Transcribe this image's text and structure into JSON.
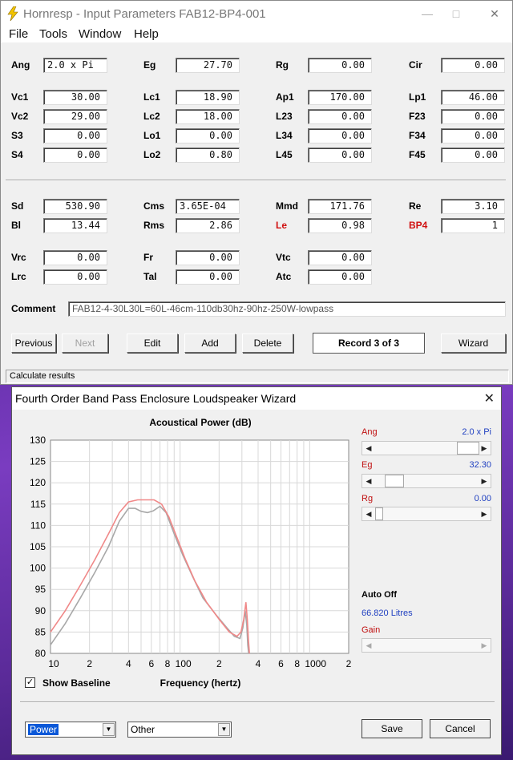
{
  "main_window": {
    "title": "Hornresp - Input Parameters   FAB12-BP4-001",
    "menu": [
      "File",
      "Tools",
      "Window",
      "Help"
    ],
    "params": {
      "ang": {
        "label": "Ang",
        "value": "2.0 x Pi"
      },
      "eg": {
        "label": "Eg",
        "value": "27.70"
      },
      "rg": {
        "label": "Rg",
        "value": "0.00"
      },
      "cir": {
        "label": "Cir",
        "value": "0.00"
      },
      "vc1": {
        "label": "Vc1",
        "value": "30.00"
      },
      "lc1": {
        "label": "Lc1",
        "value": "18.90"
      },
      "ap1": {
        "label": "Ap1",
        "value": "170.00"
      },
      "lp1": {
        "label": "Lp1",
        "value": "46.00"
      },
      "vc2": {
        "label": "Vc2",
        "value": "29.00"
      },
      "lc2": {
        "label": "Lc2",
        "value": "18.00"
      },
      "l23": {
        "label": "L23",
        "value": "0.00"
      },
      "f23": {
        "label": "F23",
        "value": "0.00"
      },
      "s3": {
        "label": "S3",
        "value": "0.00"
      },
      "lo1": {
        "label": "Lo1",
        "value": "0.00"
      },
      "l34": {
        "label": "L34",
        "value": "0.00"
      },
      "f34": {
        "label": "F34",
        "value": "0.00"
      },
      "s4": {
        "label": "S4",
        "value": "0.00"
      },
      "lo2": {
        "label": "Lo2",
        "value": "0.80"
      },
      "l45": {
        "label": "L45",
        "value": "0.00"
      },
      "f45": {
        "label": "F45",
        "value": "0.00"
      },
      "sd": {
        "label": "Sd",
        "value": "530.90"
      },
      "cms": {
        "label": "Cms",
        "value": "3.65E-04"
      },
      "mmd": {
        "label": "Mmd",
        "value": "171.76"
      },
      "re": {
        "label": "Re",
        "value": "3.10"
      },
      "bl": {
        "label": "Bl",
        "value": "13.44"
      },
      "rms": {
        "label": "Rms",
        "value": "2.86"
      },
      "le": {
        "label": "Le",
        "value": "0.98"
      },
      "bp4": {
        "label": "BP4",
        "value": "1"
      },
      "vrc": {
        "label": "Vrc",
        "value": "0.00"
      },
      "fr": {
        "label": "Fr",
        "value": "0.00"
      },
      "vtc": {
        "label": "Vtc",
        "value": "0.00"
      },
      "lrc": {
        "label": "Lrc",
        "value": "0.00"
      },
      "tal": {
        "label": "Tal",
        "value": "0.00"
      },
      "atc": {
        "label": "Atc",
        "value": "0.00"
      }
    },
    "comment_label": "Comment",
    "comment": "FAB12-4-30L30L=60L-46cm-110db30hz-90hz-250W-lowpass",
    "buttons": {
      "previous": "Previous",
      "next": "Next",
      "edit": "Edit",
      "add": "Add",
      "delete": "Delete",
      "record": "Record 3 of 3",
      "wizard": "Wizard"
    },
    "status": "Calculate results",
    "colors": {
      "red_label": "#d01010"
    }
  },
  "wizard": {
    "title": "Fourth Order Band Pass Enclosure Loudspeaker Wizard",
    "controls": {
      "ang": {
        "label": "Ang",
        "value": "2.0 x Pi"
      },
      "eg": {
        "label": "Eg",
        "value": "32.30"
      },
      "rg": {
        "label": "Rg",
        "value": "0.00"
      },
      "auto_off": "Auto Off",
      "litres": "66.820 Litres",
      "gain": {
        "label": "Gain"
      }
    },
    "show_baseline": "Show Baseline",
    "dropdown1": "Power",
    "dropdown2": "Other",
    "save": "Save",
    "cancel": "Cancel",
    "colors": {
      "value_blue": "#1f3fc0",
      "current_curve": "#f08888",
      "baseline_curve": "#a8a8a8"
    }
  },
  "chart_data": {
    "type": "line",
    "title": "Acoustical Power (dB)",
    "xlabel": "Frequency (hertz)",
    "ylabel": "",
    "x_scale": "log",
    "xlim": [
      10,
      2000
    ],
    "ylim": [
      80,
      130
    ],
    "y_ticks": [
      130,
      125,
      120,
      115,
      110,
      105,
      100,
      95,
      90,
      85,
      80
    ],
    "x_tick_labels": [
      {
        "x": 10,
        "label": "10"
      },
      {
        "x": 20,
        "label": "2"
      },
      {
        "x": 40,
        "label": "4"
      },
      {
        "x": 60,
        "label": "6"
      },
      {
        "x": 80,
        "label": "8"
      },
      {
        "x": 100,
        "label": "100"
      },
      {
        "x": 200,
        "label": "2"
      },
      {
        "x": 400,
        "label": "4"
      },
      {
        "x": 600,
        "label": "6"
      },
      {
        "x": 800,
        "label": "8"
      },
      {
        "x": 1000,
        "label": "1000"
      },
      {
        "x": 2000,
        "label": "2"
      }
    ],
    "grid": true,
    "series": [
      {
        "color": "#f08888",
        "points": [
          [
            10,
            85
          ],
          [
            13,
            90
          ],
          [
            17,
            96
          ],
          [
            22,
            102
          ],
          [
            28,
            108
          ],
          [
            34,
            113
          ],
          [
            40,
            115.5
          ],
          [
            47,
            116
          ],
          [
            55,
            116
          ],
          [
            63,
            116
          ],
          [
            72,
            115
          ],
          [
            82,
            112
          ],
          [
            95,
            107
          ],
          [
            110,
            102
          ],
          [
            130,
            97
          ],
          [
            160,
            92
          ],
          [
            200,
            88
          ],
          [
            240,
            85
          ],
          [
            275,
            84
          ],
          [
            295,
            85
          ],
          [
            310,
            88
          ],
          [
            322,
            92
          ],
          [
            330,
            88
          ],
          [
            337,
            83
          ],
          [
            343,
            80
          ]
        ]
      },
      {
        "color": "#a8a8a8",
        "points": [
          [
            10,
            82
          ],
          [
            13,
            87
          ],
          [
            17,
            93
          ],
          [
            22,
            99
          ],
          [
            28,
            105
          ],
          [
            34,
            111
          ],
          [
            40,
            114
          ],
          [
            45,
            114
          ],
          [
            50,
            113.3
          ],
          [
            56,
            113
          ],
          [
            62,
            113.4
          ],
          [
            70,
            114.5
          ],
          [
            78,
            113
          ],
          [
            90,
            108
          ],
          [
            105,
            103
          ],
          [
            125,
            98
          ],
          [
            150,
            93
          ],
          [
            190,
            89
          ],
          [
            230,
            86
          ],
          [
            262,
            84
          ],
          [
            290,
            83.5
          ],
          [
            305,
            86
          ],
          [
            318,
            90
          ],
          [
            327,
            86.5
          ],
          [
            333,
            82
          ],
          [
            338,
            80
          ]
        ]
      }
    ]
  }
}
